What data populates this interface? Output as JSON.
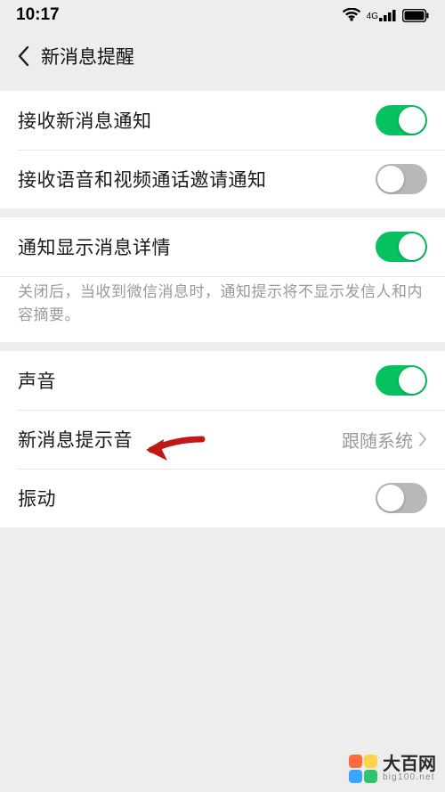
{
  "statusbar": {
    "time": "10:17",
    "network_label": "4G"
  },
  "header": {
    "title": "新消息提醒"
  },
  "groups": [
    {
      "items": [
        {
          "key": "receive-msg",
          "label": "接收新消息通知",
          "type": "toggle",
          "on": true
        },
        {
          "key": "receive-call",
          "label": "接收语音和视频通话邀请通知",
          "type": "toggle",
          "on": false
        }
      ]
    },
    {
      "items": [
        {
          "key": "show-detail",
          "label": "通知显示消息详情",
          "type": "toggle",
          "on": true
        }
      ],
      "hint": "关闭后，当收到微信消息时，通知提示将不显示发信人和内容摘要。"
    },
    {
      "items": [
        {
          "key": "sound",
          "label": "声音",
          "type": "toggle",
          "on": true
        },
        {
          "key": "tone",
          "label": "新消息提示音",
          "type": "link",
          "value": "跟随系统"
        },
        {
          "key": "vibrate",
          "label": "振动",
          "type": "toggle",
          "on": false
        }
      ]
    }
  ],
  "watermark": {
    "name": "大百网",
    "domain": "big100.net",
    "colors": {
      "tl": "#ff6a3d",
      "tr": "#ffd24a",
      "bl": "#3aa6ff",
      "br": "#2fc46b"
    }
  }
}
